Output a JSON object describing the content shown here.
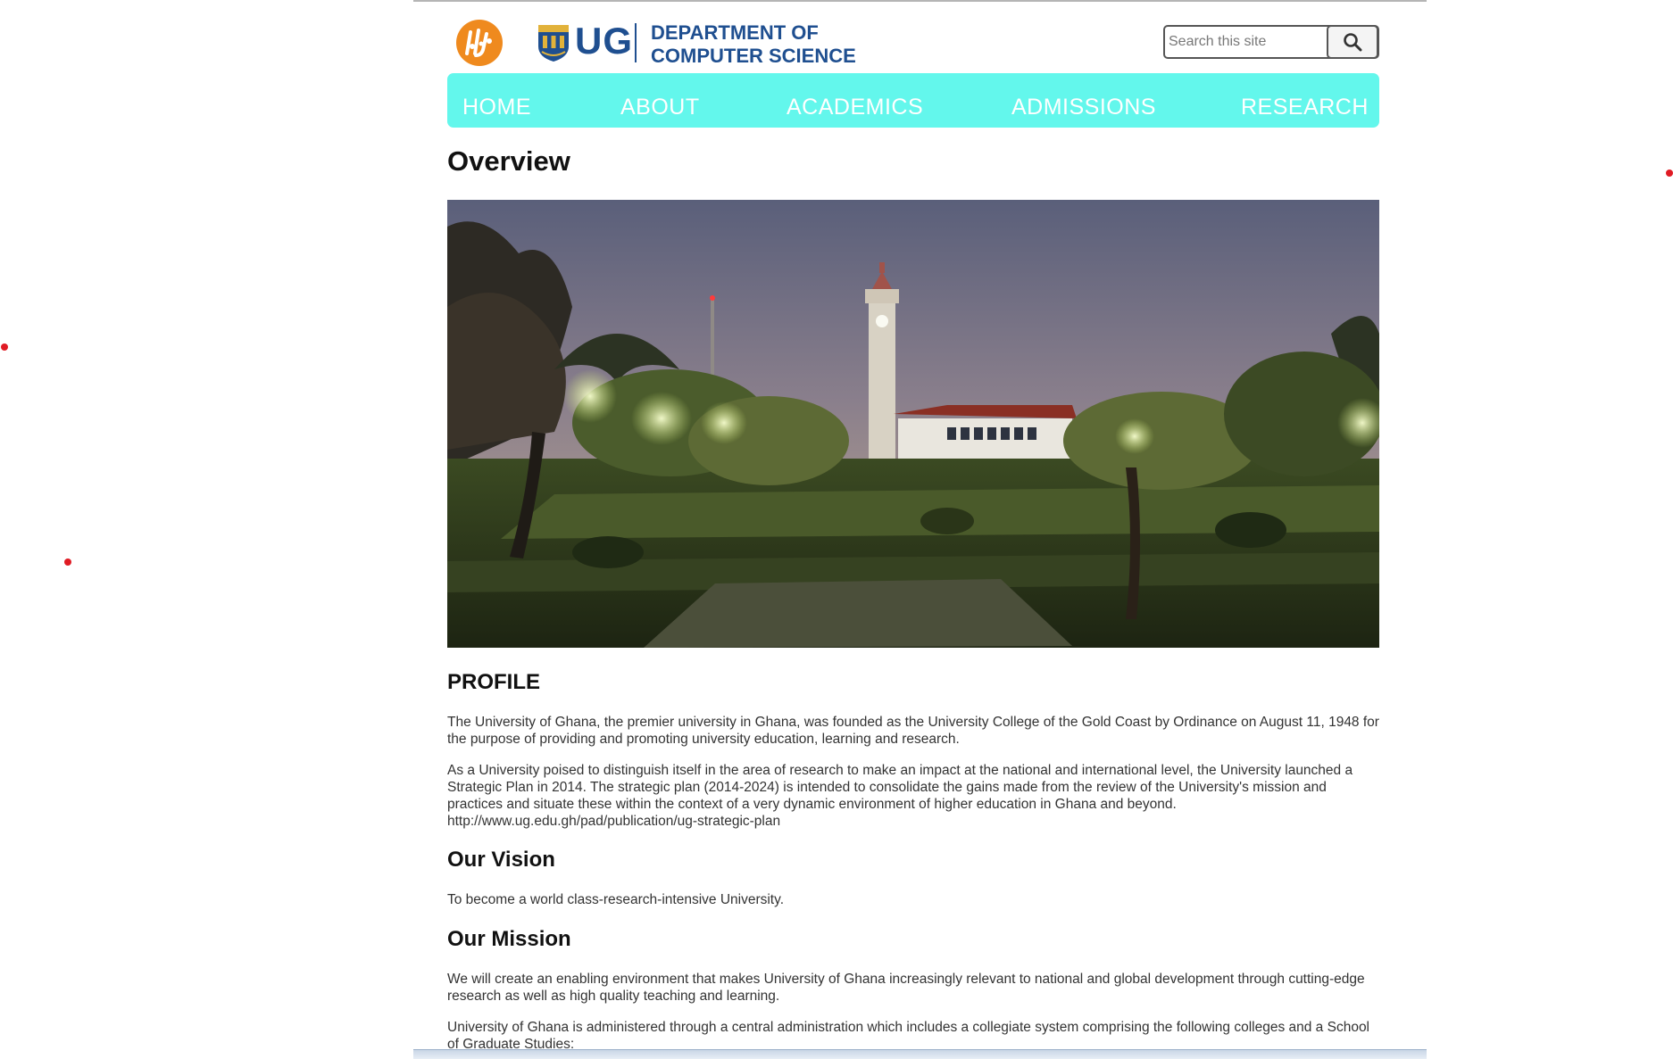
{
  "header": {
    "ug_text": "UG",
    "dept_line1": "DEPARTMENT OF",
    "dept_line2": "COMPUTER SCIENCE",
    "logo_icon": "cs-department-logo-icon",
    "crest_icon": "ug-crest-icon"
  },
  "search": {
    "placeholder": "Search this site",
    "button_icon": "search-icon"
  },
  "nav": {
    "items": [
      {
        "label": "HOME"
      },
      {
        "label": "ABOUT"
      },
      {
        "label": "ACADEMICS"
      },
      {
        "label": "ADMISSIONS"
      },
      {
        "label": "RESEARCH"
      }
    ]
  },
  "main": {
    "title": "Overview",
    "hero_alt": "University of Ghana campus with clock tower at night",
    "profile_heading": "PROFILE",
    "profile_p1": "The University of Ghana, the premier university in Ghana, was founded as the University College of the Gold Coast by Ordinance on August 11, 1948 for the purpose of providing and promoting university education, learning and research.",
    "profile_p2": "As a University poised to distinguish itself in the area of research to make an impact at the national and international level, the University launched a Strategic Plan in 2014. The strategic plan (2014-2024) is intended to consolidate the gains made from the review of the University's mission and practices and situate these within the context of a very dynamic environment of higher education in Ghana and beyond. http://www.ug.edu.gh/pad/publication/ug-strategic-plan",
    "vision_heading": "Our Vision",
    "vision_text": "To become a world class-research-intensive University.",
    "mission_heading": "Our Mission",
    "mission_text": "We will create an enabling environment that makes University of Ghana increasingly relevant to national and global development through cutting-edge research as well as high quality teaching and learning.",
    "admin_text": "University of Ghana is administered through a central administration which includes a collegiate system comprising the following colleges and a School of Graduate Studies:"
  },
  "colors": {
    "nav_bg": "#63f7ec",
    "brand_blue": "#1f4f90",
    "logo_orange": "#ef8a1e"
  }
}
